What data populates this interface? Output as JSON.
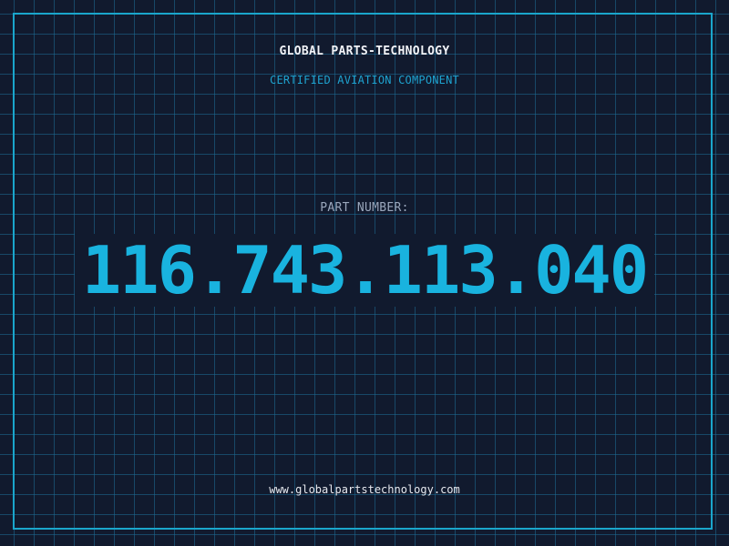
{
  "header": {
    "brand": "GLOBAL PARTS-TECHNOLOGY",
    "subtitle": "CERTIFIED AVIATION COMPONENT"
  },
  "part": {
    "label": "PART NUMBER:",
    "number": "116.743.113.040"
  },
  "footer": {
    "url": "www.globalpartstechnology.com"
  },
  "colors": {
    "background": "#111a2e",
    "grid": "#1e6e96",
    "frame": "#1aa6cc",
    "accent": "#19b3df",
    "label": "#9aa7bc",
    "text": "#f2f4f8"
  }
}
